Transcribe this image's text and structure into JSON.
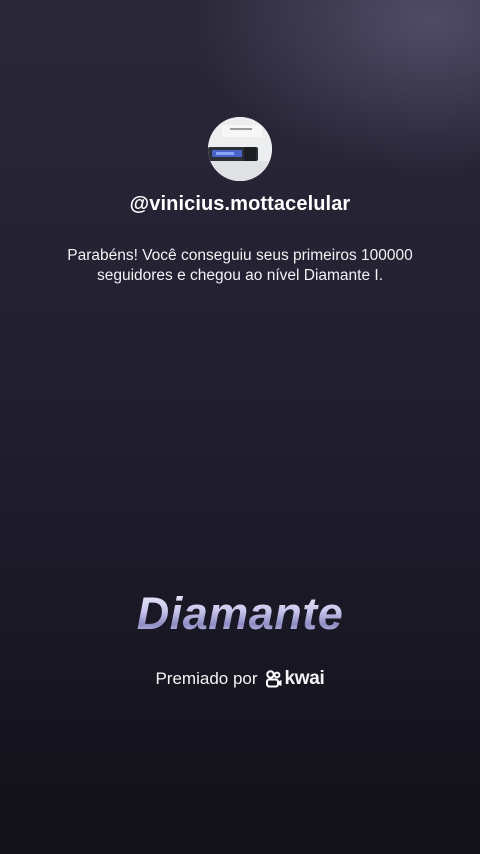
{
  "profile": {
    "username": "@vinicius.mottacelular",
    "message": "Parabéns! Você conseguiu seus primeiros 100000 seguidores e chegou ao nível Diamante I."
  },
  "level": {
    "title": "Diamante"
  },
  "award": {
    "label": "Premiado por",
    "brand": "kwai",
    "brand_icon": "kwai-logo-icon"
  }
}
